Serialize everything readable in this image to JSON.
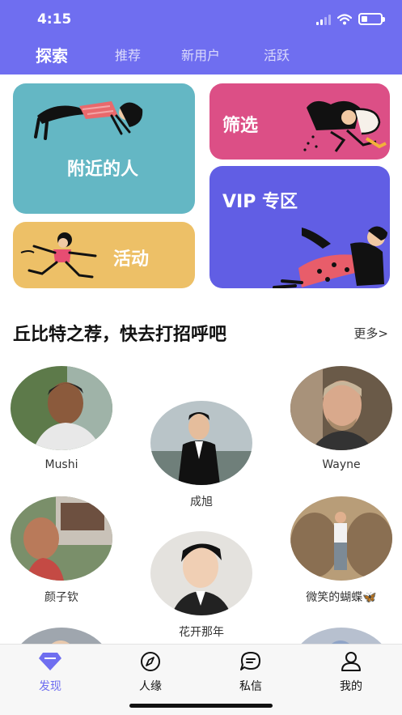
{
  "status_bar": {
    "time": "4:15"
  },
  "tabs": [
    {
      "label": "探索",
      "active": true
    },
    {
      "label": "推荐",
      "active": false
    },
    {
      "label": "新用户",
      "active": false
    },
    {
      "label": "活跃",
      "active": false
    }
  ],
  "cards": {
    "nearby": {
      "label": "附近的人",
      "color": "#64b7c4"
    },
    "filter": {
      "label": "筛选",
      "color": "#dc4f86"
    },
    "event": {
      "label": "活动",
      "color": "#edc067"
    },
    "vip": {
      "label": "VIP 专区",
      "color": "#615ee4"
    }
  },
  "section": {
    "title": "丘比特之荐，快去打招呼吧",
    "more": "更多>"
  },
  "users": [
    {
      "name": "Mushi"
    },
    {
      "name": "成旭"
    },
    {
      "name": "Wayne"
    },
    {
      "name": "颜子钦"
    },
    {
      "name": "花开那年"
    },
    {
      "name": "微笑的蝴蝶🦋"
    }
  ],
  "bottom_nav": [
    {
      "label": "发现",
      "icon": "diamond-icon",
      "active": true
    },
    {
      "label": "人缘",
      "icon": "compass-icon",
      "active": false
    },
    {
      "label": "私信",
      "icon": "message-icon",
      "active": false
    },
    {
      "label": "我的",
      "icon": "person-icon",
      "active": false
    }
  ],
  "colors": {
    "brand": "#6f6ef0"
  }
}
